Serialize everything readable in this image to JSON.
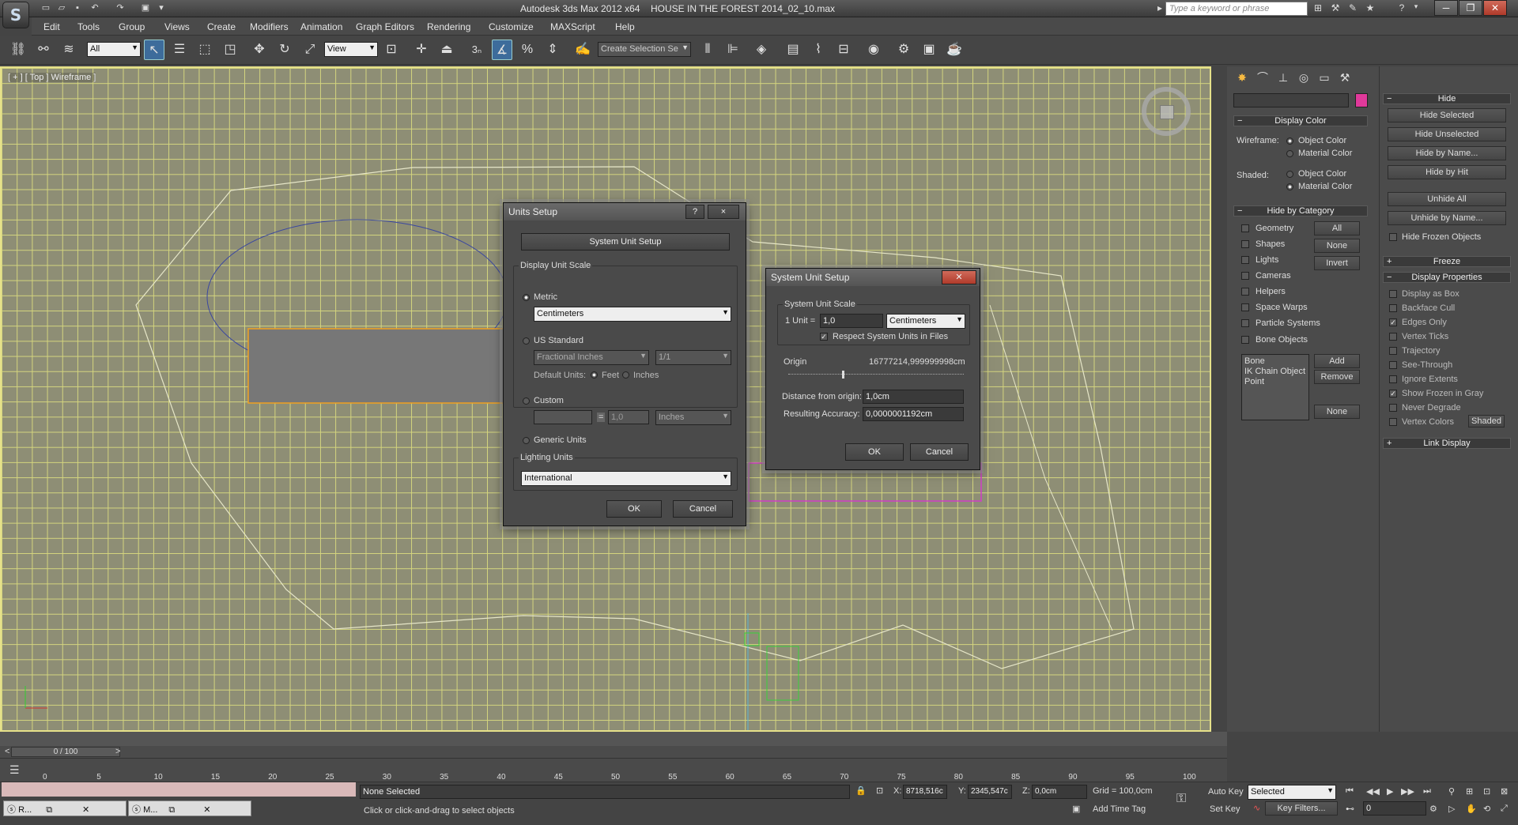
{
  "window": {
    "app_title": "Autodesk 3ds Max  2012 x64",
    "file_title": "HOUSE IN THE FOREST 2014_02_10.max",
    "search_placeholder": "Type a keyword or phrase",
    "logo": "S"
  },
  "menu": [
    "Edit",
    "Tools",
    "Group",
    "Views",
    "Create",
    "Modifiers",
    "Animation",
    "Graph Editors",
    "Rendering",
    "Customize",
    "MAXScript",
    "Help"
  ],
  "toolbar": {
    "selection_filter": "All",
    "ref_coord": "View",
    "named_selection": "Create Selection Se",
    "snap_label": "3"
  },
  "viewport": {
    "label": "[ + ] [ Top ]  Wireframe ]"
  },
  "command_panel": {
    "name_field": "",
    "object_color": "#e0399a",
    "display_color": {
      "title": "Display Color",
      "wireframe_label": "Wireframe:",
      "shaded_label": "Shaded:",
      "object_color": "Object Color",
      "material_color": "Material Color"
    },
    "hide_by_category": {
      "title": "Hide by Category",
      "items": [
        "Geometry",
        "Shapes",
        "Lights",
        "Cameras",
        "Helpers",
        "Space Warps",
        "Particle Systems",
        "Bone Objects"
      ],
      "buttons": [
        "All",
        "None",
        "Invert"
      ],
      "list": [
        "Bone",
        "IK Chain Object",
        "Point"
      ],
      "list_buttons": [
        "Add",
        "Remove",
        "None"
      ]
    }
  },
  "extra_panel": {
    "hide": {
      "title": "Hide",
      "buttons": [
        "Hide Selected",
        "Hide Unselected",
        "Hide by Name...",
        "Hide by Hit",
        "Unhide All",
        "Unhide by Name..."
      ],
      "check": "Hide Frozen Objects"
    },
    "freeze": "Freeze",
    "display_properties": {
      "title": "Display Properties",
      "items": [
        "Display as Box",
        "Backface Cull",
        "Edges Only",
        "Vertex Ticks",
        "Trajectory",
        "See-Through",
        "Ignore Extents",
        "Show Frozen in Gray",
        "Never Degrade",
        "Vertex Colors"
      ],
      "shaded_button": "Shaded"
    },
    "link_display": "Link Display"
  },
  "units_dialog": {
    "title": "Units Setup",
    "help": "?",
    "close": "×",
    "system_button": "System Unit Setup",
    "display_scale": "Display Unit Scale",
    "metric": "Metric",
    "metric_value": "Centimeters",
    "us_standard": "US Standard",
    "fractional": "Fractional Inches",
    "fraction": "1/1",
    "default_units": "Default Units:",
    "feet": "Feet",
    "inches": "Inches",
    "custom": "Custom",
    "custom_name": "",
    "equals": "=",
    "custom_value": "1,0",
    "custom_unit": "Inches",
    "generic": "Generic Units",
    "lighting": "Lighting Units",
    "lighting_value": "International",
    "ok": "OK",
    "cancel": "Cancel"
  },
  "system_dialog": {
    "title": "System Unit Setup",
    "close": "✕",
    "scale_group": "System Unit Scale",
    "unit_label": "1 Unit =",
    "unit_value": "1,0",
    "unit_type": "Centimeters",
    "respect": "Respect System Units in Files",
    "origin": "Origin",
    "origin_value": "16777214,999999998cm",
    "distance_label": "Distance from origin:",
    "distance_value": "1,0cm",
    "accuracy_label": "Resulting Accuracy:",
    "accuracy_value": "0,0000001192cm",
    "ok": "OK",
    "cancel": "Cancel"
  },
  "timeline": {
    "frame": "0 / 100",
    "ticks": [
      "0",
      "5",
      "10",
      "15",
      "20",
      "25",
      "30",
      "35",
      "40",
      "45",
      "50",
      "55",
      "60",
      "65",
      "70",
      "75",
      "80",
      "85",
      "90",
      "95",
      "100"
    ]
  },
  "status": {
    "taskbar": [
      "R...",
      "M..."
    ],
    "selected": "None Selected",
    "prompt": "Click or click-and-drag to select objects",
    "x_label": "X:",
    "x": "8718,516c",
    "y_label": "Y:",
    "y": "2345,547c",
    "z_label": "Z:",
    "z": "0,0cm",
    "grid": "Grid = 100,0cm",
    "add_time_tag": "Add Time Tag",
    "auto_key": "Auto Key",
    "set_key": "Set Key",
    "key_mode": "Selected",
    "key_filters": "Key Filters...",
    "frame_field": "0"
  }
}
